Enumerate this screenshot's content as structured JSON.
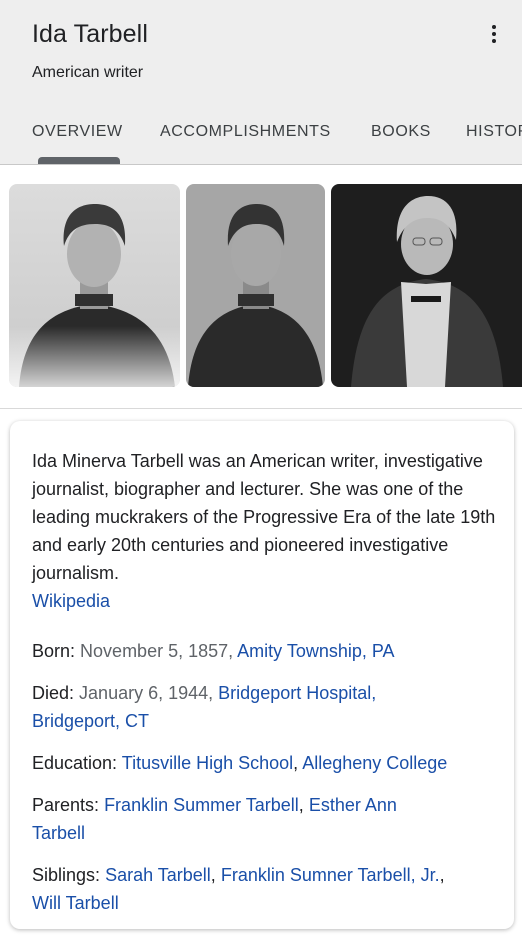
{
  "header": {
    "title": "Ida Tarbell",
    "subtitle": "American writer",
    "menu_icon": "more-vert-icon"
  },
  "tabs": [
    {
      "label": "OVERVIEW",
      "active": true
    },
    {
      "label": "ACCOMPLISHMENTS",
      "active": false
    },
    {
      "label": "BOOKS",
      "active": false
    },
    {
      "label": "HISTORY",
      "active": false
    }
  ],
  "images": [
    {
      "name": "portrait-photo-1"
    },
    {
      "name": "portrait-photo-2"
    },
    {
      "name": "portrait-photo-3"
    }
  ],
  "description": {
    "text": "Ida Minerva Tarbell was an American writer, investigative journalist, biographer and lecturer. She was one of the leading muckrakers of the Progressive Era of the late 19th and early 20th centuries and pioneered investigative journalism.",
    "source_link": "Wikipedia"
  },
  "facts": {
    "born": {
      "label": "Born:",
      "value": "November 5, 1857,",
      "link": "Amity Township, PA"
    },
    "died": {
      "label": "Died:",
      "value": "January 6, 1944,",
      "link1": "Bridgeport Hospital,",
      "link2": "Bridgeport, CT"
    },
    "education": {
      "label": "Education:",
      "link1": "Titusville High School",
      "sep": ",",
      "link2": "Allegheny College"
    },
    "parents": {
      "label": "Parents:",
      "link1": "Franklin Summer Tarbell",
      "sep": ",",
      "link2": "Esther Ann",
      "link2_cont": "Tarbell"
    },
    "siblings": {
      "label": "Siblings:",
      "link1": "Sarah Tarbell",
      "sep1": ",",
      "link2": "Franklin Sumner Tarbell, Jr.",
      "sep2": ",",
      "link3": "Will Tarbell"
    }
  },
  "colors": {
    "header_bg": "#eeeeee",
    "link": "#1a4fa8",
    "muted": "#5f6368",
    "text": "#202124"
  }
}
